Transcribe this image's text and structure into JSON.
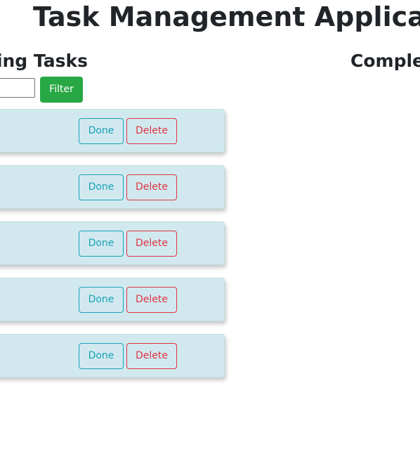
{
  "app": {
    "title": "Task Management Application"
  },
  "pending": {
    "heading": "ding Tasks",
    "filter_value": "",
    "filter_label": "Filter",
    "tasks": [
      {
        "done_label": "Done",
        "delete_label": "Delete"
      },
      {
        "done_label": "Done",
        "delete_label": "Delete"
      },
      {
        "done_label": "Done",
        "delete_label": "Delete"
      },
      {
        "done_label": "Done",
        "delete_label": "Delete"
      },
      {
        "done_label": "Done",
        "delete_label": "Delete"
      }
    ]
  },
  "completed": {
    "heading": "Comple"
  },
  "colors": {
    "filter_button": "#28a745",
    "done_outline": "#17a2b8",
    "delete_outline": "#dc3545",
    "task_card": "#d1e9ee"
  }
}
